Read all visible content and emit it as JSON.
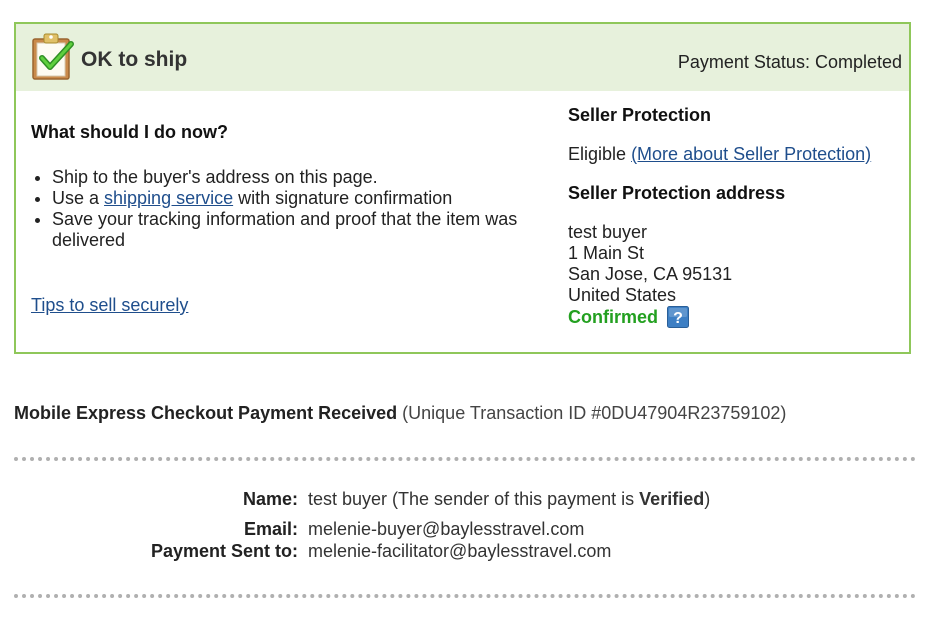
{
  "status_box": {
    "title": "OK to ship",
    "payment_status": "Payment Status: Completed",
    "icon": "clipboard-checkmark-icon",
    "colors": {
      "border": "#8fc75a",
      "header_bg": "#e7f1dc",
      "confirmed": "#23a020"
    }
  },
  "what_to_do": {
    "heading": "What should I do now?",
    "item1": "Ship to the buyer's address on this page.",
    "item2_prefix": "Use a ",
    "item2_link": "shipping service",
    "item2_suffix": " with signature confirmation",
    "item3": "Save your tracking information and proof that the item was delivered"
  },
  "tips_link": "Tips to sell securely",
  "seller_protection": {
    "heading": "Seller Protection",
    "eligible": "Eligible",
    "more_link": "(More about Seller Protection)",
    "address_heading": "Seller Protection address",
    "address_lines": [
      "test buyer",
      "1 Main St",
      "San Jose, CA 95131",
      "United States"
    ],
    "confirmed": "Confirmed",
    "help_icon": "question-mark-icon"
  },
  "receipt": {
    "title": "Mobile Express Checkout Payment Received",
    "transaction_id": "(Unique Transaction ID #0DU47904R23759102)"
  },
  "details": {
    "name_label": "Name:",
    "name_value": "test buyer",
    "name_note_prefix": " (The sender of this payment is ",
    "name_note_bold": "Verified",
    "name_note_suffix": ")",
    "email_label": "Email:",
    "email_value": "melenie-buyer@baylesstravel.com",
    "sent_to_label": "Payment Sent to:",
    "sent_to_value": "melenie-facilitator@baylesstravel.com"
  }
}
